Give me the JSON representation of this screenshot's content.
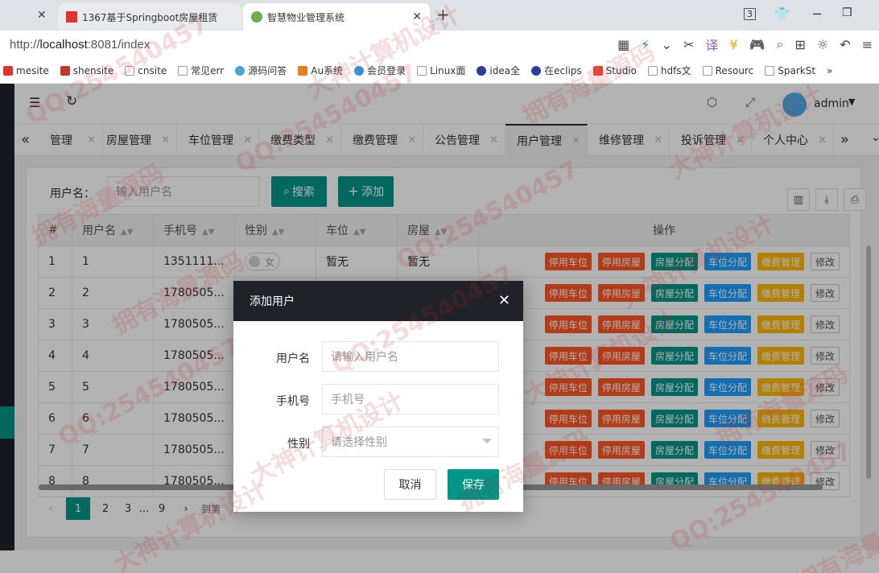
{
  "browser": {
    "tabs": [
      {
        "title": "1367基于Springboot房屋租赁",
        "active": false
      },
      {
        "title": "智慧物业管理系统",
        "active": true
      }
    ],
    "url_prefix": "http://",
    "url_host": "localhost",
    "url_rest": ":8081/index",
    "bookmarks": [
      "mesite",
      "shensite",
      "cnsite",
      "常见err",
      "源码问答",
      "Au系统",
      "会员登录",
      "Linux面",
      "idea全",
      "在eclips",
      "Studio",
      "hdfs文",
      "Resourc",
      "SparkSt"
    ],
    "bookmarks_more": "»"
  },
  "header": {
    "user": "admin"
  },
  "page_tabs": [
    {
      "label": "管理",
      "active": false
    },
    {
      "label": "房屋管理",
      "active": false
    },
    {
      "label": "车位管理",
      "active": false
    },
    {
      "label": "缴费类型",
      "active": false
    },
    {
      "label": "缴费管理",
      "active": false
    },
    {
      "label": "公告管理",
      "active": false
    },
    {
      "label": "用户管理",
      "active": true
    },
    {
      "label": "维修管理",
      "active": false
    },
    {
      "label": "投诉管理",
      "active": false
    },
    {
      "label": "个人中心",
      "active": false
    }
  ],
  "search": {
    "label": "用户名：",
    "placeholder": "输入用户名",
    "search_label": "搜索",
    "add_label": "添加"
  },
  "table": {
    "headers": [
      "#",
      "用户名",
      "手机号",
      "性别",
      "车位",
      "房屋",
      "操作"
    ],
    "rows": [
      {
        "idx": "1",
        "username": "1",
        "phone": "1351111...",
        "gender": "女",
        "parking": "暂无",
        "house": "暂无"
      },
      {
        "idx": "2",
        "username": "2",
        "phone": "1780505...",
        "gender": "",
        "parking": "",
        "house": ""
      },
      {
        "idx": "3",
        "username": "3",
        "phone": "1780505...",
        "gender": "",
        "parking": "",
        "house": ""
      },
      {
        "idx": "4",
        "username": "4",
        "phone": "1780505...",
        "gender": "",
        "parking": "",
        "house": ""
      },
      {
        "idx": "5",
        "username": "5",
        "phone": "1780505...",
        "gender": "",
        "parking": "",
        "house": ""
      },
      {
        "idx": "6",
        "username": "6",
        "phone": "1780505...",
        "gender": "",
        "parking": "",
        "house": ""
      },
      {
        "idx": "7",
        "username": "7",
        "phone": "1780505...",
        "gender": "",
        "parking": "",
        "house": ""
      },
      {
        "idx": "8",
        "username": "8",
        "phone": "1780505...",
        "gender": "",
        "parking": "",
        "house": ""
      }
    ],
    "actions": [
      "停用车位",
      "停用房屋",
      "房屋分配",
      "车位分配",
      "缴费管理",
      "修改"
    ]
  },
  "pager": {
    "pages": [
      "1",
      "2",
      "3",
      "...",
      "9"
    ],
    "goto_label": "到第"
  },
  "modal": {
    "title": "添加用户",
    "username_label": "用户名",
    "username_placeholder": "请输入用户名",
    "phone_label": "手机号",
    "phone_placeholder": "手机号",
    "gender_label": "性别",
    "gender_placeholder": "请选择性别",
    "cancel_label": "取消",
    "save_label": "保存"
  },
  "watermarks": [
    "QQ:254540457",
    "大神计算机设计",
    "拥有海量源码"
  ],
  "colors": {
    "primary": "#009688",
    "danger": "#ff5722",
    "info": "#1e9fff",
    "warn": "#ffb800",
    "dark": "#20222a"
  }
}
